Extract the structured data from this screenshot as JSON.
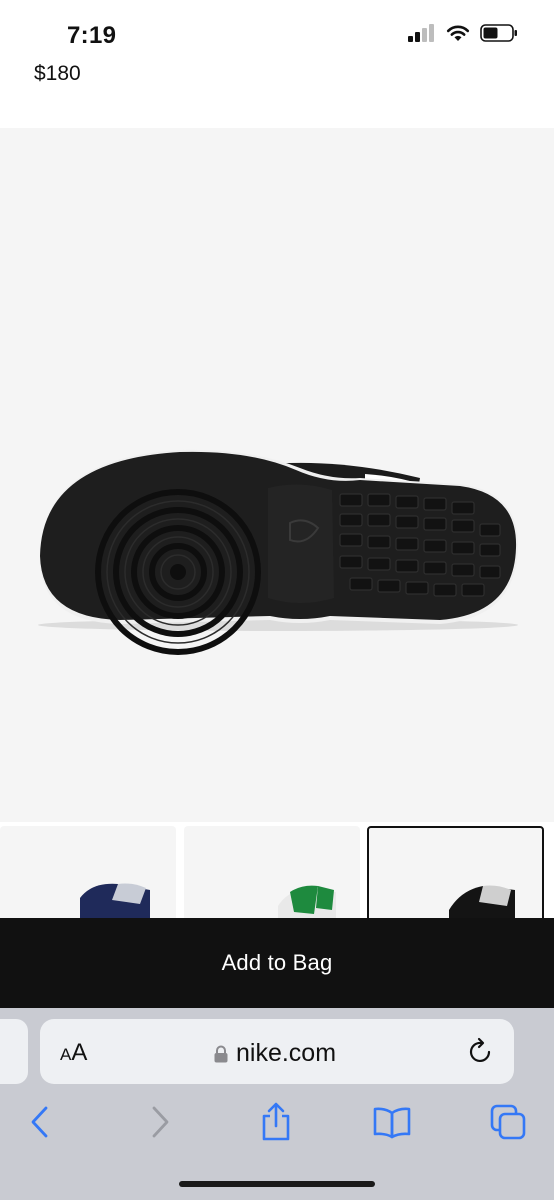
{
  "status": {
    "time": "7:19"
  },
  "product": {
    "price": "$180"
  },
  "gallery": {
    "thumbnails": [
      {
        "colorway": "navy",
        "accent": "#1f2a5a",
        "selected": false
      },
      {
        "colorway": "green",
        "accent": "#1e8a3e",
        "selected": false
      },
      {
        "colorway": "black",
        "accent": "#111111",
        "selected": true
      }
    ]
  },
  "cta": {
    "add_to_bag": "Add to Bag"
  },
  "browser": {
    "aa_small": "A",
    "aa_large": "A",
    "domain": "nike.com"
  },
  "colors": {
    "cta_bg": "#111111",
    "hero_bg": "#f5f5f5",
    "safari_accent": "#3478f6"
  }
}
